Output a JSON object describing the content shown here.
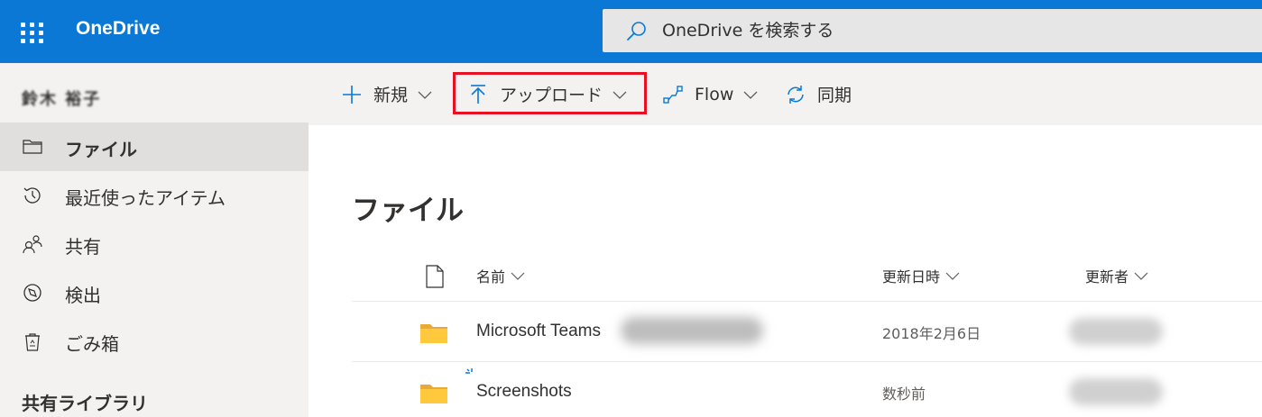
{
  "header": {
    "app_name": "OneDrive",
    "search_placeholder": "OneDrive を検索する",
    "accent": "#0a78d4"
  },
  "sidebar": {
    "user_name": "鈴木 裕子",
    "items": [
      {
        "label": "ファイル",
        "icon": "folder-icon",
        "selected": true
      },
      {
        "label": "最近使ったアイテム",
        "icon": "history-icon",
        "selected": false
      },
      {
        "label": "共有",
        "icon": "people-icon",
        "selected": false
      },
      {
        "label": "検出",
        "icon": "compass-icon",
        "selected": false
      },
      {
        "label": "ごみ箱",
        "icon": "recycle-bin-icon",
        "selected": false
      }
    ],
    "section_heading": "共有ライブラリ"
  },
  "toolbar": {
    "new_label": "新規",
    "upload_label": "アップロード",
    "flow_label": "Flow",
    "sync_label": "同期",
    "highlight_color": "#e81123"
  },
  "main": {
    "title": "ファイル",
    "columns": {
      "name": "名前",
      "modified": "更新日時",
      "modified_by": "更新者"
    },
    "rows": [
      {
        "name": "Microsoft Teams",
        "modified": "2018年2月6日"
      },
      {
        "name": "Screenshots",
        "modified": "数秒前"
      }
    ]
  }
}
